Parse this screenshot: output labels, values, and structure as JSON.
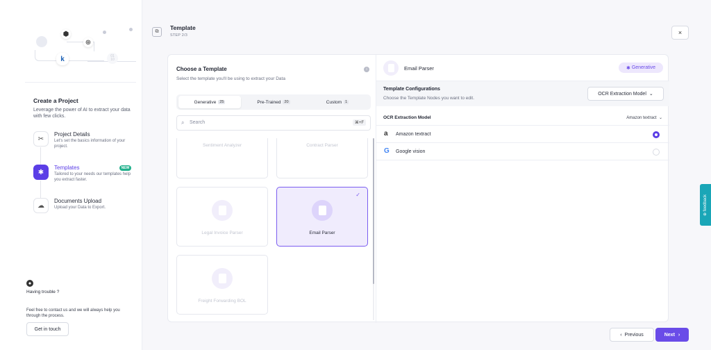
{
  "sidebar": {
    "hero_labels": {
      "k": "k",
      "num1": "01",
      "num2": "10"
    },
    "heading": "Create a Project",
    "subheading": "Leverage the power of AI to extract your data with few clicks.",
    "steps": [
      {
        "title": "Project Details",
        "desc": "Let's set the basics information of your project.",
        "icon": "scissors-icon"
      },
      {
        "title": "Templates",
        "desc": "Tailored to your needs our templates help you extract faster.",
        "icon": "puzzle-icon",
        "badge": "NEW"
      },
      {
        "title": "Documents Upload",
        "desc": "Upload your Data to Export.",
        "icon": "cloud-upload-icon"
      }
    ],
    "help_title": "Having trouble ?",
    "help_text": "Feel free to contact us and we will always help you through the process.",
    "contact_label": "Get in touch"
  },
  "header": {
    "title": "Template",
    "step": "STEP 2/3",
    "close_label": "×"
  },
  "left_panel": {
    "title": "Choose a Template",
    "subtitle": "Select the template you'll be using to extract your Data",
    "info_glyph": "i",
    "tabs": [
      {
        "label": "Generative",
        "count": "25"
      },
      {
        "label": "Pre-Trained",
        "count": "20"
      },
      {
        "label": "Custom",
        "count": "1"
      }
    ],
    "search": {
      "placeholder": "Search",
      "shortcut": "⌘+F",
      "icon_glyph": "⌕"
    },
    "templates": [
      {
        "label": "Sentiment Analyzer"
      },
      {
        "label": "Contract Parser"
      },
      {
        "label": "Legal Invoice Parser"
      },
      {
        "label": "Email Parser",
        "selected": true,
        "check": "✓"
      },
      {
        "label": "Freight Forwarding BOL"
      }
    ]
  },
  "right_panel": {
    "title": "Email Parser",
    "badge": "Generative",
    "badge_glyph": "✱",
    "config_title": "Template Configurations",
    "config_sub": "Choose the Template Nodes you want to edit.",
    "config_select": "OCR Extraction Model",
    "caret": "⌄",
    "ocr_title": "OCR Extraction Model",
    "ocr_value": "Amazon textract",
    "options": [
      {
        "label": "Amazon textract",
        "logo": "a",
        "selected": true
      },
      {
        "label": "Google vision",
        "logo": "G",
        "selected": false
      }
    ]
  },
  "footer": {
    "prev_label": "Previous",
    "prev_glyph": "‹",
    "next_label": "Next",
    "next_glyph": "›"
  },
  "feedback_label": "⊕ feedback",
  "colors": {
    "accent": "#5b3ee6",
    "accent_light": "#ede7fd",
    "feedback": "#1aa6b7"
  }
}
